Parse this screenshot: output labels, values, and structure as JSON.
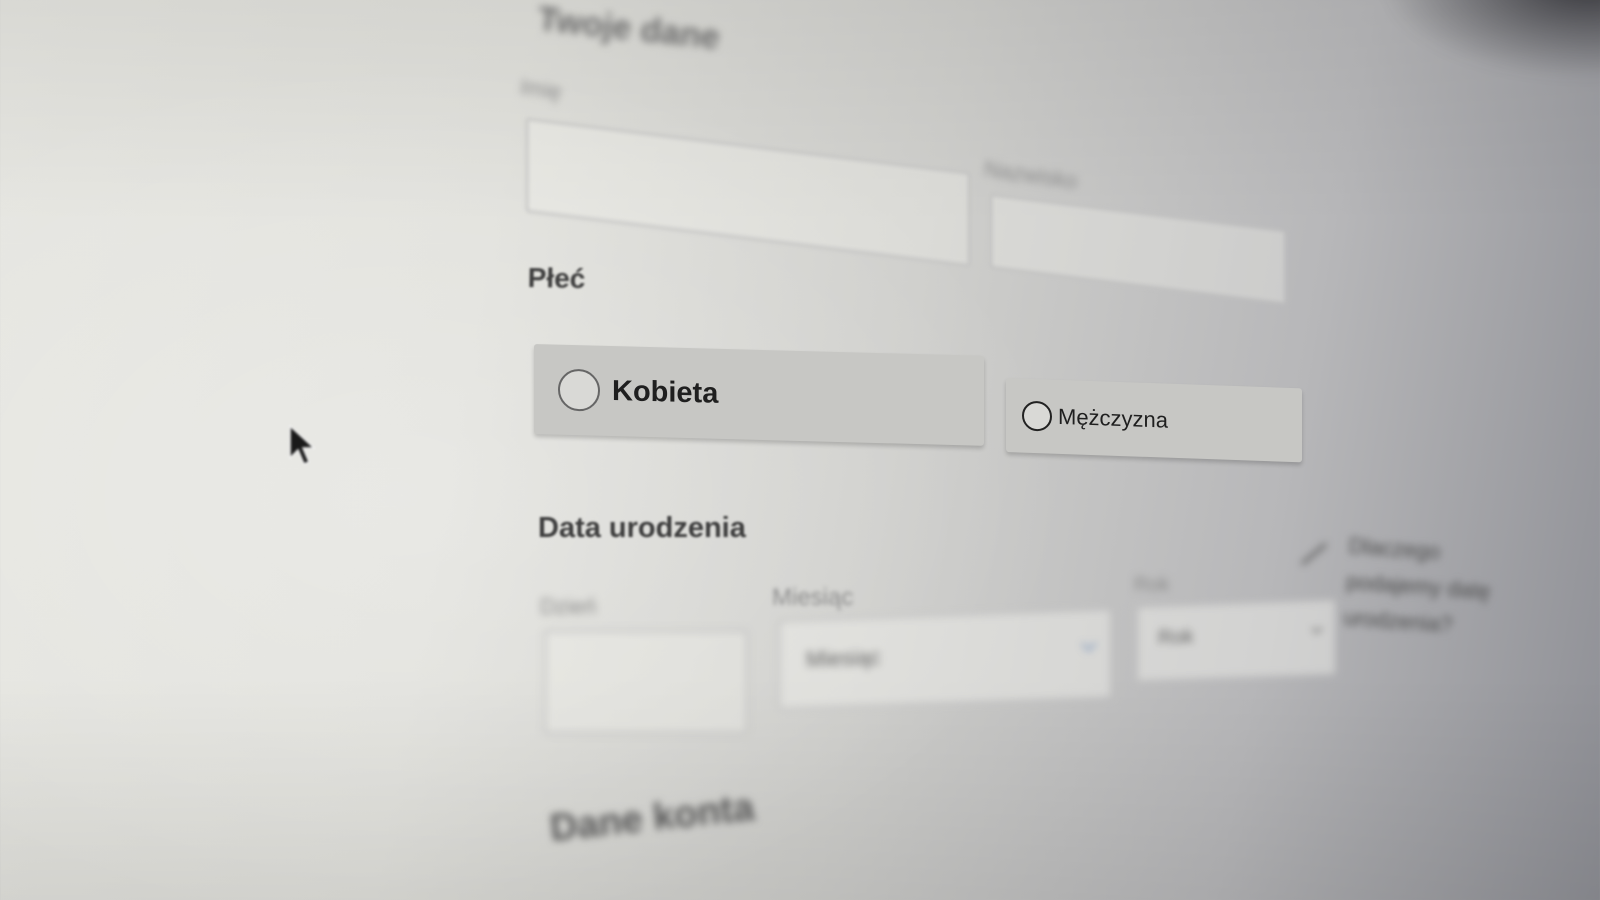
{
  "form": {
    "top_heading": "Twoje dane",
    "first_name_label": "Imię",
    "last_name_label": "Nazwisko",
    "gender": {
      "heading": "Płeć",
      "options": [
        {
          "label": "Kobieta",
          "selected": false
        },
        {
          "label": "Mężczyzna",
          "selected": false
        }
      ]
    },
    "birth_date": {
      "heading": "Data urodzenia",
      "day_label": "Dzień",
      "month_label": "Miesiąc",
      "month_value": "Miesiąc",
      "year_label": "Rok",
      "year_value": "Rok",
      "side_note": "Dlaczego podajemy datę urodzenia?"
    },
    "account_heading": "Dane konta"
  },
  "icons": {
    "cursor": "mouse-pointer-icon",
    "select_arrow": "chevron-down-icon"
  },
  "colors": {
    "radio_card": "#c7c7c4",
    "heading": "#3e3e3e"
  }
}
